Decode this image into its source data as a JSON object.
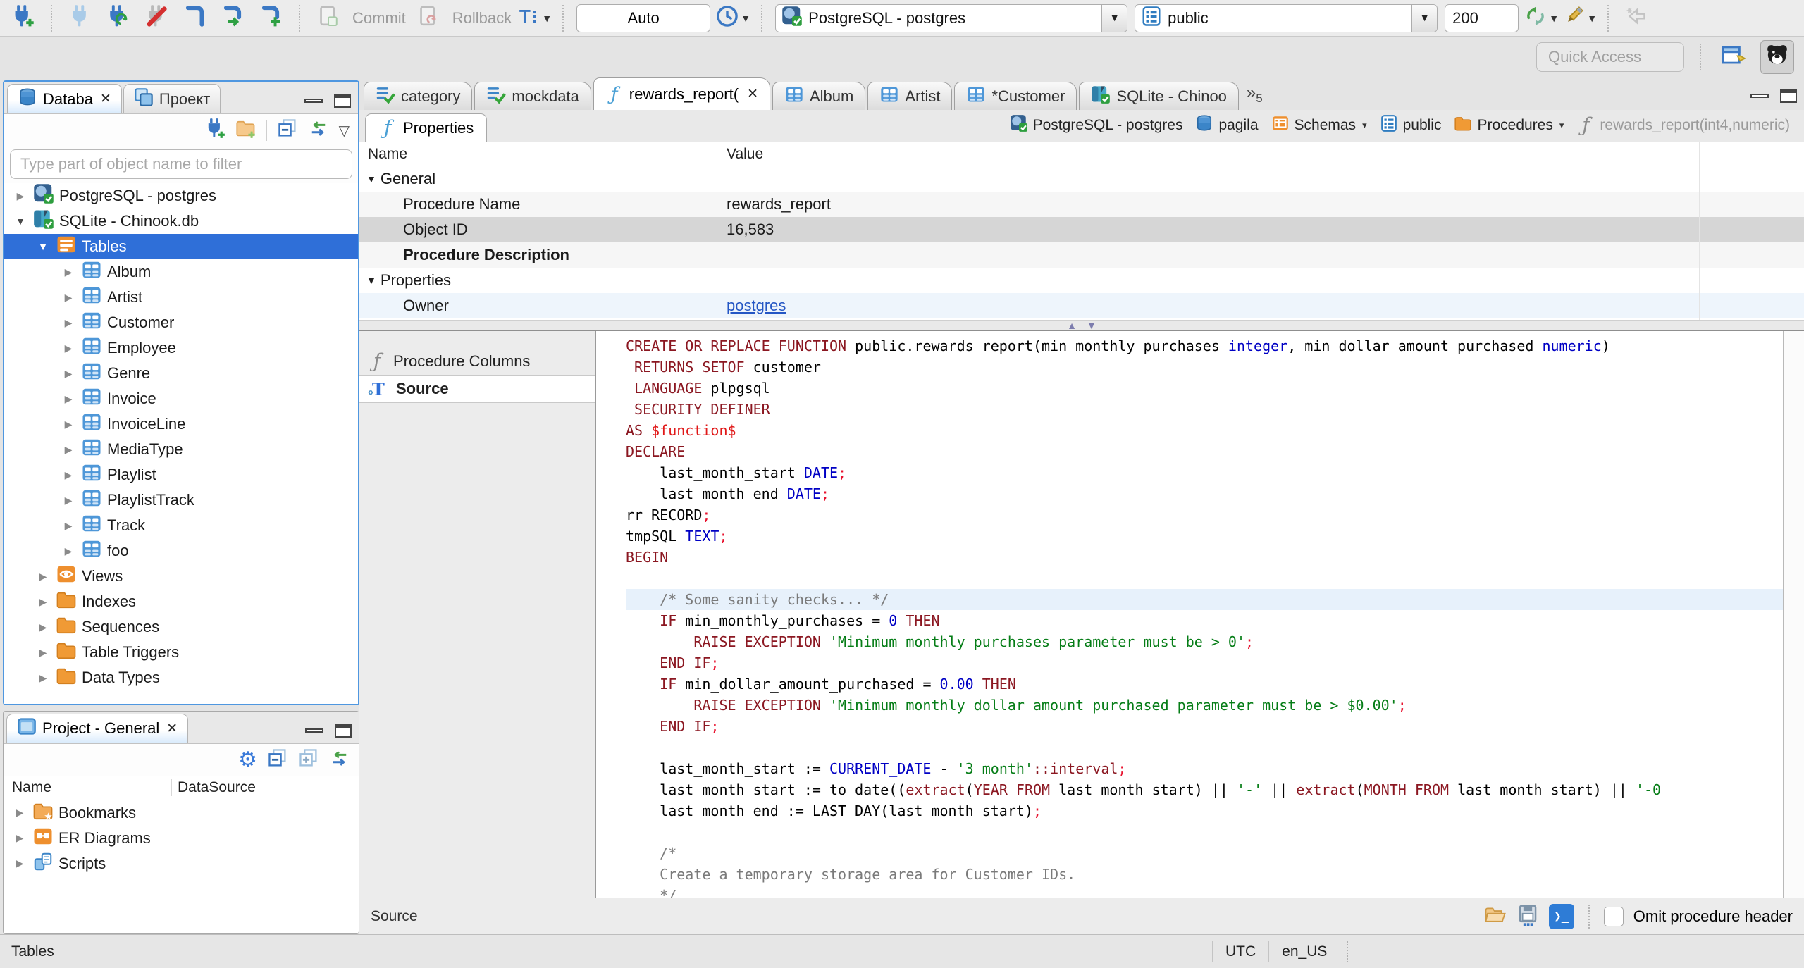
{
  "toolbar": {
    "commit_label": "Commit",
    "rollback_label": "Rollback",
    "auto_value": "Auto",
    "connection_value": "PostgreSQL - postgres",
    "schema_value": "public",
    "fetch_size_value": "200",
    "quick_access_placeholder": "Quick Access"
  },
  "editor_tabs": [
    {
      "label": "category",
      "icon": "script-check",
      "active": false,
      "closable": false
    },
    {
      "label": "mockdata",
      "icon": "script-check",
      "active": false,
      "closable": false
    },
    {
      "label": "rewards_report(",
      "icon": "fn",
      "active": true,
      "closable": true
    },
    {
      "label": "Album",
      "icon": "table",
      "active": false,
      "closable": false
    },
    {
      "label": "Artist",
      "icon": "table",
      "active": false,
      "closable": false
    },
    {
      "label": "*Customer",
      "icon": "table",
      "active": false,
      "closable": false
    },
    {
      "label": "SQLite - Chinoo",
      "icon": "sqlite",
      "active": false,
      "closable": false
    }
  ],
  "tab_overflow_count": "5",
  "properties_tab_label": "Properties",
  "breadcrumb": [
    {
      "label": "PostgreSQL - postgres",
      "icon": "pg",
      "dropdown": false,
      "muted": false
    },
    {
      "label": "pagila",
      "icon": "dbstack",
      "dropdown": false,
      "muted": false
    },
    {
      "label": "Schemas",
      "icon": "schemas-folder",
      "dropdown": true,
      "muted": false
    },
    {
      "label": "public",
      "icon": "schema",
      "dropdown": false,
      "muted": false
    },
    {
      "label": "Procedures",
      "icon": "folder",
      "dropdown": true,
      "muted": false
    },
    {
      "label": "rewards_report(int4,numeric)",
      "icon": "fn-gray",
      "dropdown": false,
      "muted": true
    }
  ],
  "properties_grid": {
    "columns": [
      "Name",
      "Value"
    ],
    "rows": [
      {
        "name": "General",
        "value": "",
        "group": true,
        "style": "plain"
      },
      {
        "name": "Procedure Name",
        "value": "rewards_report",
        "group": false,
        "style": "alt"
      },
      {
        "name": "Object ID",
        "value": "16,583",
        "group": false,
        "style": "sel"
      },
      {
        "name": "Procedure Description",
        "value": "",
        "group": false,
        "style": "alt bold"
      },
      {
        "name": "Properties",
        "value": "",
        "group": true,
        "style": "plain"
      },
      {
        "name": "Owner",
        "value": "postgres",
        "group": false,
        "style": "hover",
        "link": true
      }
    ]
  },
  "subtabs": [
    {
      "label": "Procedure Columns",
      "icon": "fn-gray",
      "active": false
    },
    {
      "label": "Source",
      "icon": "srcT",
      "active": true
    }
  ],
  "navigator": {
    "tabs": [
      {
        "label": "Databa",
        "icon": "dbstack",
        "closable": true,
        "active": true
      },
      {
        "label": "Проект",
        "icon": "window",
        "closable": false,
        "active": false
      }
    ],
    "filter_placeholder": "Type part of object name to filter",
    "tree": [
      {
        "label": "PostgreSQL - postgres",
        "icon": "pg",
        "level": 0,
        "exp": "closed",
        "selected": false
      },
      {
        "label": "SQLite - Chinook.db",
        "icon": "sqlite",
        "level": 0,
        "exp": "open",
        "selected": false
      },
      {
        "label": "Tables",
        "icon": "tables-folder",
        "level": 1,
        "exp": "open",
        "selected": true
      },
      {
        "label": "Album",
        "icon": "table",
        "level": 2,
        "exp": "closed",
        "selected": false
      },
      {
        "label": "Artist",
        "icon": "table",
        "level": 2,
        "exp": "closed",
        "selected": false
      },
      {
        "label": "Customer",
        "icon": "table",
        "level": 2,
        "exp": "closed",
        "selected": false
      },
      {
        "label": "Employee",
        "icon": "table",
        "level": 2,
        "exp": "closed",
        "selected": false
      },
      {
        "label": "Genre",
        "icon": "table",
        "level": 2,
        "exp": "closed",
        "selected": false
      },
      {
        "label": "Invoice",
        "icon": "table",
        "level": 2,
        "exp": "closed",
        "selected": false
      },
      {
        "label": "InvoiceLine",
        "icon": "table",
        "level": 2,
        "exp": "closed",
        "selected": false
      },
      {
        "label": "MediaType",
        "icon": "table",
        "level": 2,
        "exp": "closed",
        "selected": false
      },
      {
        "label": "Playlist",
        "icon": "table",
        "level": 2,
        "exp": "closed",
        "selected": false
      },
      {
        "label": "PlaylistTrack",
        "icon": "table",
        "level": 2,
        "exp": "closed",
        "selected": false
      },
      {
        "label": "Track",
        "icon": "table",
        "level": 2,
        "exp": "closed",
        "selected": false
      },
      {
        "label": "foo",
        "icon": "table",
        "level": 2,
        "exp": "closed",
        "selected": false
      },
      {
        "label": "Views",
        "icon": "eye",
        "level": 1,
        "exp": "closed",
        "selected": false
      },
      {
        "label": "Indexes",
        "icon": "folder",
        "level": 1,
        "exp": "closed",
        "selected": false
      },
      {
        "label": "Sequences",
        "icon": "folder",
        "level": 1,
        "exp": "closed",
        "selected": false
      },
      {
        "label": "Table Triggers",
        "icon": "folder",
        "level": 1,
        "exp": "closed",
        "selected": false
      },
      {
        "label": "Data Types",
        "icon": "folder",
        "level": 1,
        "exp": "closed",
        "selected": false
      }
    ]
  },
  "project_panel": {
    "title": "Project - General",
    "columns": [
      "Name",
      "DataSource"
    ],
    "rows": [
      {
        "label": "Bookmarks",
        "icon": "folder-star"
      },
      {
        "label": "ER Diagrams",
        "icon": "er"
      },
      {
        "label": "Scripts",
        "icon": "scripts"
      }
    ]
  },
  "source_editor": {
    "status_label": "Source",
    "omit_checkbox_label": "Omit procedure header",
    "omit_checked": false,
    "highlight_line": 13,
    "code_lines": [
      [
        {
          "t": "CREATE OR REPLACE FUNCTION ",
          "c": "kw"
        },
        {
          "t": "public.rewards_report(min_monthly_purchases ",
          "c": "pl"
        },
        {
          "t": "integer",
          "c": "ty"
        },
        {
          "t": ", min_dollar_amount_purchased ",
          "c": "pl"
        },
        {
          "t": "numeric",
          "c": "ty"
        },
        {
          "t": ")",
          "c": "pl"
        }
      ],
      [
        {
          "t": " ",
          "c": "pl"
        },
        {
          "t": "RETURNS SETOF ",
          "c": "kw"
        },
        {
          "t": "customer",
          "c": "pl"
        }
      ],
      [
        {
          "t": " ",
          "c": "pl"
        },
        {
          "t": "LANGUAGE ",
          "c": "kw"
        },
        {
          "t": "plpgsql",
          "c": "pl"
        }
      ],
      [
        {
          "t": " ",
          "c": "pl"
        },
        {
          "t": "SECURITY DEFINER",
          "c": "kw"
        }
      ],
      [
        {
          "t": "AS ",
          "c": "kw"
        },
        {
          "t": "$function$",
          "c": "fn"
        }
      ],
      [
        {
          "t": "DECLARE",
          "c": "kw"
        }
      ],
      [
        {
          "t": "    last_month_start ",
          "c": "pl"
        },
        {
          "t": "DATE",
          "c": "ty"
        },
        {
          "t": ";",
          "c": "sem"
        }
      ],
      [
        {
          "t": "    last_month_end ",
          "c": "pl"
        },
        {
          "t": "DATE",
          "c": "ty"
        },
        {
          "t": ";",
          "c": "sem"
        }
      ],
      [
        {
          "t": "rr RECORD",
          "c": "pl"
        },
        {
          "t": ";",
          "c": "sem"
        }
      ],
      [
        {
          "t": "tmpSQL ",
          "c": "pl"
        },
        {
          "t": "TEXT",
          "c": "ty"
        },
        {
          "t": ";",
          "c": "sem"
        }
      ],
      [
        {
          "t": "BEGIN",
          "c": "kw"
        }
      ],
      [],
      [
        {
          "t": "    /* Some sanity checks... */",
          "c": "com"
        }
      ],
      [
        {
          "t": "    ",
          "c": "pl"
        },
        {
          "t": "IF",
          "c": "kw"
        },
        {
          "t": " min_monthly_purchases = ",
          "c": "pl"
        },
        {
          "t": "0",
          "c": "ty"
        },
        {
          "t": " ",
          "c": "pl"
        },
        {
          "t": "THEN",
          "c": "kw"
        }
      ],
      [
        {
          "t": "        ",
          "c": "pl"
        },
        {
          "t": "RAISE EXCEPTION ",
          "c": "kw"
        },
        {
          "t": "'Minimum monthly purchases parameter must be > 0'",
          "c": "str"
        },
        {
          "t": ";",
          "c": "sem"
        }
      ],
      [
        {
          "t": "    ",
          "c": "pl"
        },
        {
          "t": "END IF",
          "c": "kw"
        },
        {
          "t": ";",
          "c": "sem"
        }
      ],
      [
        {
          "t": "    ",
          "c": "pl"
        },
        {
          "t": "IF",
          "c": "kw"
        },
        {
          "t": " min_dollar_amount_purchased = ",
          "c": "pl"
        },
        {
          "t": "0.00",
          "c": "ty"
        },
        {
          "t": " ",
          "c": "pl"
        },
        {
          "t": "THEN",
          "c": "kw"
        }
      ],
      [
        {
          "t": "        ",
          "c": "pl"
        },
        {
          "t": "RAISE EXCEPTION ",
          "c": "kw"
        },
        {
          "t": "'Minimum monthly dollar amount purchased parameter must be > $0.00'",
          "c": "str"
        },
        {
          "t": ";",
          "c": "sem"
        }
      ],
      [
        {
          "t": "    ",
          "c": "pl"
        },
        {
          "t": "END IF",
          "c": "kw"
        },
        {
          "t": ";",
          "c": "sem"
        }
      ],
      [],
      [
        {
          "t": "    last_month_start := ",
          "c": "pl"
        },
        {
          "t": "CURRENT_DATE",
          "c": "ty"
        },
        {
          "t": " - ",
          "c": "pl"
        },
        {
          "t": "'3 month'",
          "c": "str"
        },
        {
          "t": "::interval",
          "c": "kw"
        },
        {
          "t": ";",
          "c": "sem"
        }
      ],
      [
        {
          "t": "    last_month_start := to_date((",
          "c": "pl"
        },
        {
          "t": "extract",
          "c": "kw"
        },
        {
          "t": "(",
          "c": "pl"
        },
        {
          "t": "YEAR FROM",
          "c": "kw"
        },
        {
          "t": " last_month_start) || ",
          "c": "pl"
        },
        {
          "t": "'-'",
          "c": "str"
        },
        {
          "t": " || ",
          "c": "pl"
        },
        {
          "t": "extract",
          "c": "kw"
        },
        {
          "t": "(",
          "c": "pl"
        },
        {
          "t": "MONTH FROM",
          "c": "kw"
        },
        {
          "t": " last_month_start) || ",
          "c": "pl"
        },
        {
          "t": "'-0",
          "c": "str"
        }
      ],
      [
        {
          "t": "    last_month_end := LAST_DAY(last_month_start)",
          "c": "pl"
        },
        {
          "t": ";",
          "c": "sem"
        }
      ],
      [],
      [
        {
          "t": "    /*",
          "c": "com"
        }
      ],
      [
        {
          "t": "    Create a temporary storage area for Customer IDs.",
          "c": "com"
        }
      ],
      [
        {
          "t": "    */",
          "c": "com"
        }
      ]
    ]
  },
  "status_bar": {
    "left": "Tables",
    "timezone": "UTC",
    "locale": "en_US"
  },
  "icons": [
    "connect-new-icon",
    "connect-icon",
    "reconnect-icon",
    "disconnect-icon",
    "sql-editor-icon",
    "sql-editor-new-icon",
    "sql-console-icon",
    "commit-icon",
    "rollback-icon",
    "tx-mode-icon",
    "history-icon",
    "refresh-icon",
    "edit-icon",
    "back-icon",
    "perspective-icon",
    "dbeaver-icon",
    "collapse-all-icon",
    "expand-all-icon",
    "link-editor-icon",
    "gear-icon",
    "view-menu-icon",
    "folder-icon",
    "table-icon",
    "eye-icon",
    "function-icon",
    "schema-icon",
    "database-icon",
    "open-file-icon",
    "save-icon",
    "terminal-icon",
    "minimize-icon",
    "maximize-icon",
    "close-icon"
  ]
}
